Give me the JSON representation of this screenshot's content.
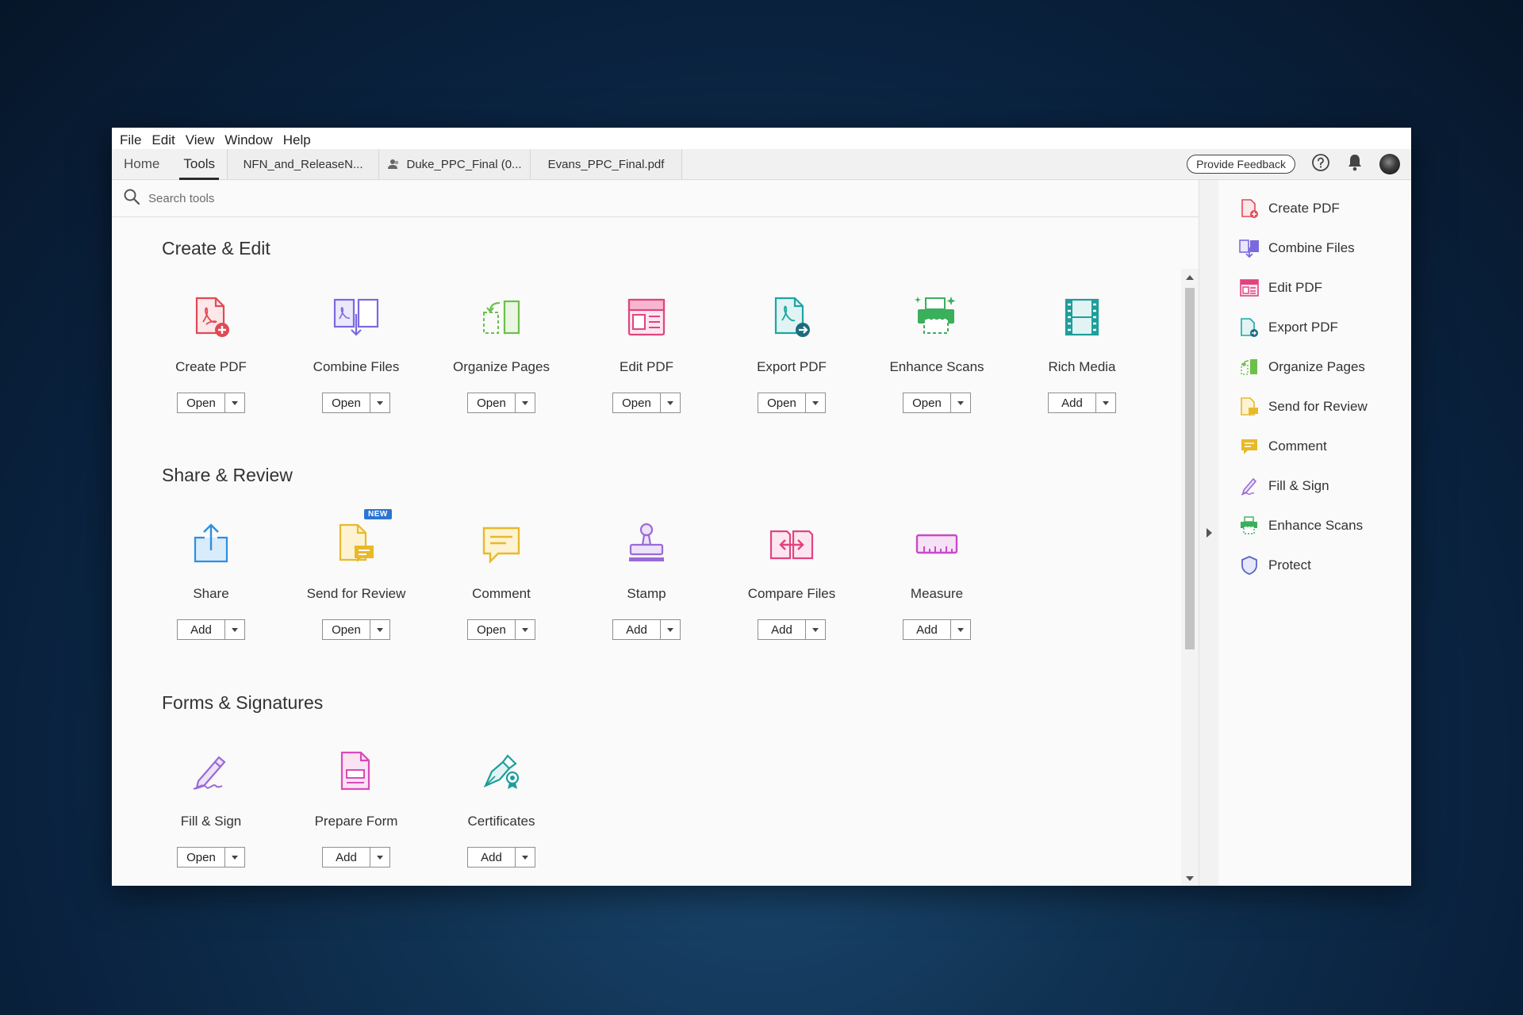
{
  "menu": [
    "File",
    "Edit",
    "View",
    "Window",
    "Help"
  ],
  "nav_tabs": [
    {
      "label": "Home"
    },
    {
      "label": "Tools"
    }
  ],
  "doc_tabs": [
    {
      "label": "NFN_and_ReleaseN..."
    },
    {
      "label": "Duke_PPC_Final (0..."
    },
    {
      "label": "Evans_PPC_Final.pdf"
    }
  ],
  "header": {
    "feedback_label": "Provide Feedback"
  },
  "search": {
    "placeholder": "Search tools"
  },
  "sections": [
    {
      "title": "Create & Edit",
      "tools": [
        {
          "name": "Create PDF",
          "action": "Open",
          "icon": "create-pdf-icon",
          "color": "#e04a55"
        },
        {
          "name": "Combine Files",
          "action": "Open",
          "icon": "combine-files-icon",
          "color": "#7a6ae0"
        },
        {
          "name": "Organize Pages",
          "action": "Open",
          "icon": "organize-pages-icon",
          "color": "#6cc04a"
        },
        {
          "name": "Edit PDF",
          "action": "Open",
          "icon": "edit-pdf-icon",
          "color": "#e0447f"
        },
        {
          "name": "Export PDF",
          "action": "Open",
          "icon": "export-pdf-icon",
          "color": "#1ea6a3"
        },
        {
          "name": "Enhance Scans",
          "action": "Open",
          "icon": "enhance-scans-icon",
          "color": "#3aaf5c"
        },
        {
          "name": "Rich Media",
          "action": "Add",
          "icon": "rich-media-icon",
          "color": "#1e9e9b"
        }
      ]
    },
    {
      "title": "Share & Review",
      "tools": [
        {
          "name": "Share",
          "action": "Add",
          "icon": "share-icon",
          "color": "#2d8fe0"
        },
        {
          "name": "Send for Review",
          "action": "Open",
          "icon": "send-for-review-icon",
          "color": "#e8b92a",
          "badge": "NEW"
        },
        {
          "name": "Comment",
          "action": "Open",
          "icon": "comment-icon",
          "color": "#e8b92a"
        },
        {
          "name": "Stamp",
          "action": "Add",
          "icon": "stamp-icon",
          "color": "#9a6ad8"
        },
        {
          "name": "Compare Files",
          "action": "Add",
          "icon": "compare-files-icon",
          "color": "#e0447f"
        },
        {
          "name": "Measure",
          "action": "Add",
          "icon": "measure-icon",
          "color": "#c84ac8"
        }
      ]
    },
    {
      "title": "Forms & Signatures",
      "tools": [
        {
          "name": "Fill & Sign",
          "action": "Open",
          "icon": "fill-sign-icon",
          "color": "#9a6ad8"
        },
        {
          "name": "Prepare Form",
          "action": "Add",
          "icon": "prepare-form-icon",
          "color": "#d94ab8"
        },
        {
          "name": "Certificates",
          "action": "Add",
          "icon": "certificates-icon",
          "color": "#1e9e9b"
        }
      ]
    }
  ],
  "right_pane": [
    {
      "label": "Create PDF",
      "icon": "create-pdf-icon"
    },
    {
      "label": "Combine Files",
      "icon": "combine-files-icon"
    },
    {
      "label": "Edit PDF",
      "icon": "edit-pdf-icon"
    },
    {
      "label": "Export PDF",
      "icon": "export-pdf-icon"
    },
    {
      "label": "Organize Pages",
      "icon": "organize-pages-icon"
    },
    {
      "label": "Send for Review",
      "icon": "send-for-review-icon"
    },
    {
      "label": "Comment",
      "icon": "comment-icon"
    },
    {
      "label": "Fill & Sign",
      "icon": "fill-sign-icon"
    },
    {
      "label": "Enhance Scans",
      "icon": "enhance-scans-icon"
    },
    {
      "label": "Protect",
      "icon": "protect-icon"
    }
  ]
}
